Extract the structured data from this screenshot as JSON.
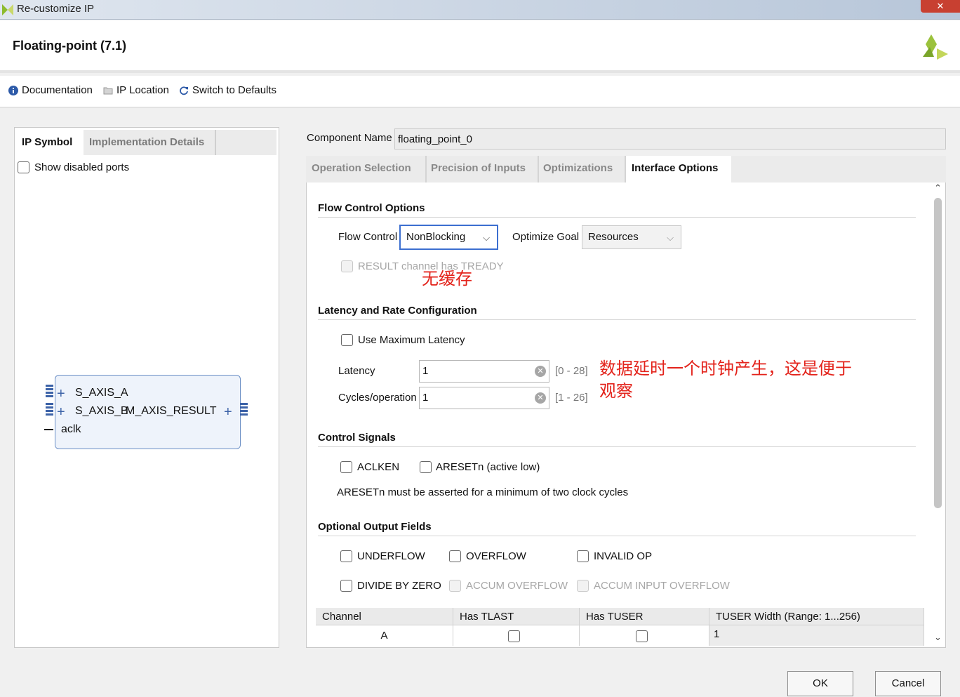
{
  "window": {
    "title": "Re-customize IP",
    "close_label": "✕"
  },
  "header": {
    "title": "Floating-point (7.1)"
  },
  "toolbar": {
    "documentation": "Documentation",
    "ip_location": "IP Location",
    "switch_defaults": "Switch to Defaults"
  },
  "left": {
    "tabs": [
      "IP Symbol",
      "Implementation Details"
    ],
    "show_disabled_ports": "Show disabled ports",
    "ports": {
      "s_axis_a": "S_AXIS_A",
      "s_axis_b": "S_AXIS_B",
      "m_axis_result": "M_AXIS_RESULT",
      "aclk": "aclk"
    }
  },
  "component": {
    "label": "Component Name",
    "value": "floating_point_0"
  },
  "tabs": [
    "Operation Selection",
    "Precision of Inputs",
    "Optimizations",
    "Interface Options"
  ],
  "flow": {
    "title": "Flow Control Options",
    "flow_control_label": "Flow Control",
    "flow_control_value": "NonBlocking",
    "optimize_goal_label": "Optimize Goal",
    "optimize_goal_value": "Resources",
    "result_tready": "RESULT channel has TREADY",
    "annotation": "无缓存"
  },
  "latency": {
    "title": "Latency and Rate Configuration",
    "use_max": "Use Maximum Latency",
    "latency_label": "Latency",
    "latency_value": "1",
    "latency_range": "[0 - 28]",
    "cycles_label": "Cycles/operation",
    "cycles_value": "1",
    "cycles_range": "[1 - 26]",
    "annotation_line1": "数据延时一个时钟产生，这是便于",
    "annotation_line2": "观察"
  },
  "control": {
    "title": "Control Signals",
    "aclken": "ACLKEN",
    "aresetn": "ARESETn (active low)",
    "note": "ARESETn must be asserted for a minimum of two clock cycles"
  },
  "optional": {
    "title": "Optional Output Fields",
    "underflow": "UNDERFLOW",
    "overflow": "OVERFLOW",
    "invalid_op": "INVALID OP",
    "divide_by_zero": "DIVIDE BY ZERO",
    "accum_overflow": "ACCUM OVERFLOW",
    "accum_input_overflow": "ACCUM INPUT OVERFLOW"
  },
  "table": {
    "headers": [
      "Channel",
      "Has TLAST",
      "Has TUSER",
      "TUSER Width (Range: 1...256)"
    ],
    "rows": [
      {
        "channel": "A",
        "tuser_width": "1"
      }
    ]
  },
  "footer": {
    "ok": "OK",
    "cancel": "Cancel"
  },
  "colors": {
    "accent": "#3c6fd0",
    "annotation": "#e3231b",
    "brand_green": "#8dbb2e"
  }
}
